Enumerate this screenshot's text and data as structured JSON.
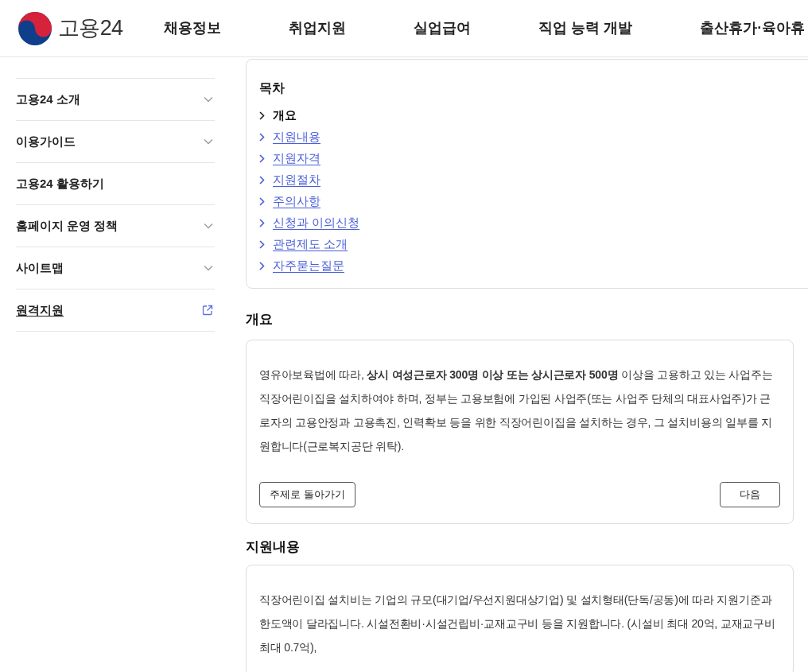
{
  "header": {
    "logo_text": "고용24",
    "nav": [
      "채용정보",
      "취업지원",
      "실업급여",
      "직업 능력 개발",
      "출산휴가·육아휴"
    ]
  },
  "sidebar": {
    "items": [
      {
        "label": "고용24 소개",
        "kind": "expandable"
      },
      {
        "label": "이용가이드",
        "kind": "expandable"
      },
      {
        "label": "고용24 활용하기",
        "kind": "plain"
      },
      {
        "label": "홈페이지 운영 정책",
        "kind": "expandable"
      },
      {
        "label": "사이트맵",
        "kind": "expandable"
      },
      {
        "label": "원격지원",
        "kind": "external"
      }
    ]
  },
  "toc": {
    "title": "목차",
    "items": [
      {
        "label": "개요",
        "selected": true
      },
      {
        "label": "지원내용",
        "selected": false
      },
      {
        "label": "지원자격",
        "selected": false
      },
      {
        "label": "지원절차",
        "selected": false
      },
      {
        "label": "주의사항",
        "selected": false
      },
      {
        "label": "신청과 이의신청",
        "selected": false
      },
      {
        "label": "관련제도 소개",
        "selected": false
      },
      {
        "label": "자주묻는질문",
        "selected": false
      }
    ]
  },
  "sections": [
    {
      "title": "개요",
      "paragraph": "영유아보육법에 따라, **상시 여성근로자 300명 이상 또는 상시근로자 500명** 이상을 고용하고 있는 사업주는 직장어린이집을 설치하여야 하며, 정부는 고용보험에 가입된 사업주(또는 사업주 단체의 대표사업주)가 근로자의 고용안정과 고용촉진, 인력확보 등을 위한 직장어린이집을 설치하는 경우, 그 설치비용의 일부를 지원합니다(근로복지공단 위탁).",
      "back_button": "주제로 돌아가기",
      "next_button": "다음"
    },
    {
      "title": "지원내용",
      "paragraph": "직장어린이집 설치비는 기업의 규모(대기업/우선지원대상기업) 및 설치형태(단독/공동)에 따라 지원기준과 한도액이 달라집니다. 시설전환비·시설건립비·교재교구비 등을 지원합니다. (시설비 최대 20억, 교재교구비 최대 0.7억),"
    }
  ]
}
